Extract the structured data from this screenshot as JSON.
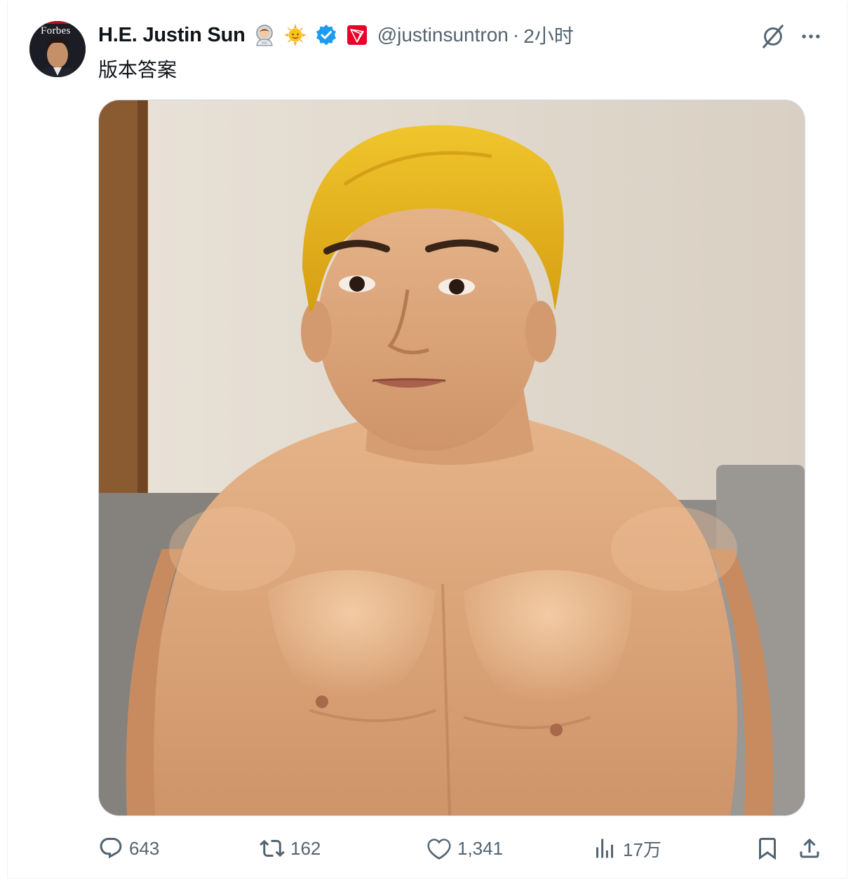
{
  "tweet": {
    "display_name": "H.E. Justin Sun",
    "handle": "@justinsuntron",
    "separator": "·",
    "time": "2小时",
    "text": "版本答案",
    "avatar_badge": "Forbes",
    "badges": [
      "astronaut-emoji",
      "sun-emoji",
      "verified-badge",
      "tron-logo"
    ],
    "verified_color": "#1d9bf0",
    "tron_color": "#eb0029"
  },
  "actions": {
    "replies": "643",
    "reposts": "162",
    "likes": "1,341",
    "views": "17万"
  },
  "icons": [
    "grok-icon",
    "more-icon",
    "reply-icon",
    "repost-icon",
    "like-icon",
    "views-icon",
    "bookmark-icon",
    "share-icon"
  ],
  "colors": {
    "text": "#0f1419",
    "secondary": "#536471",
    "border": "#cfd9de",
    "hair": "#e6b523"
  }
}
